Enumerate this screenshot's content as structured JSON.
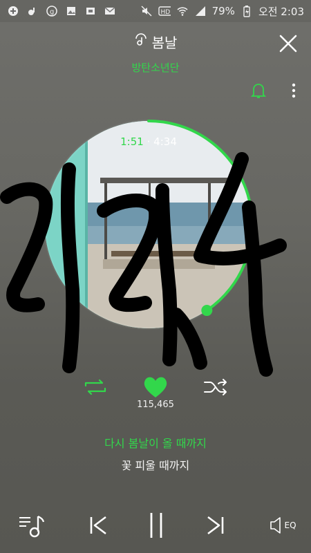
{
  "status_bar": {
    "battery_percent": "79%",
    "time": "오전 2:03"
  },
  "player": {
    "song_title": "봄날",
    "artist": "방탄소년단",
    "current_time": "1:51",
    "separator": "·",
    "total_time": "4:34",
    "progress_fraction": 0.405,
    "like_count": "115,465",
    "lyric_current": "다시 봄날이 올 때까지",
    "lyric_next": "꽃 피울 때까지",
    "eq_label": "EQ"
  },
  "colors": {
    "accent": "#32d74b",
    "handwriting": "#000000"
  }
}
